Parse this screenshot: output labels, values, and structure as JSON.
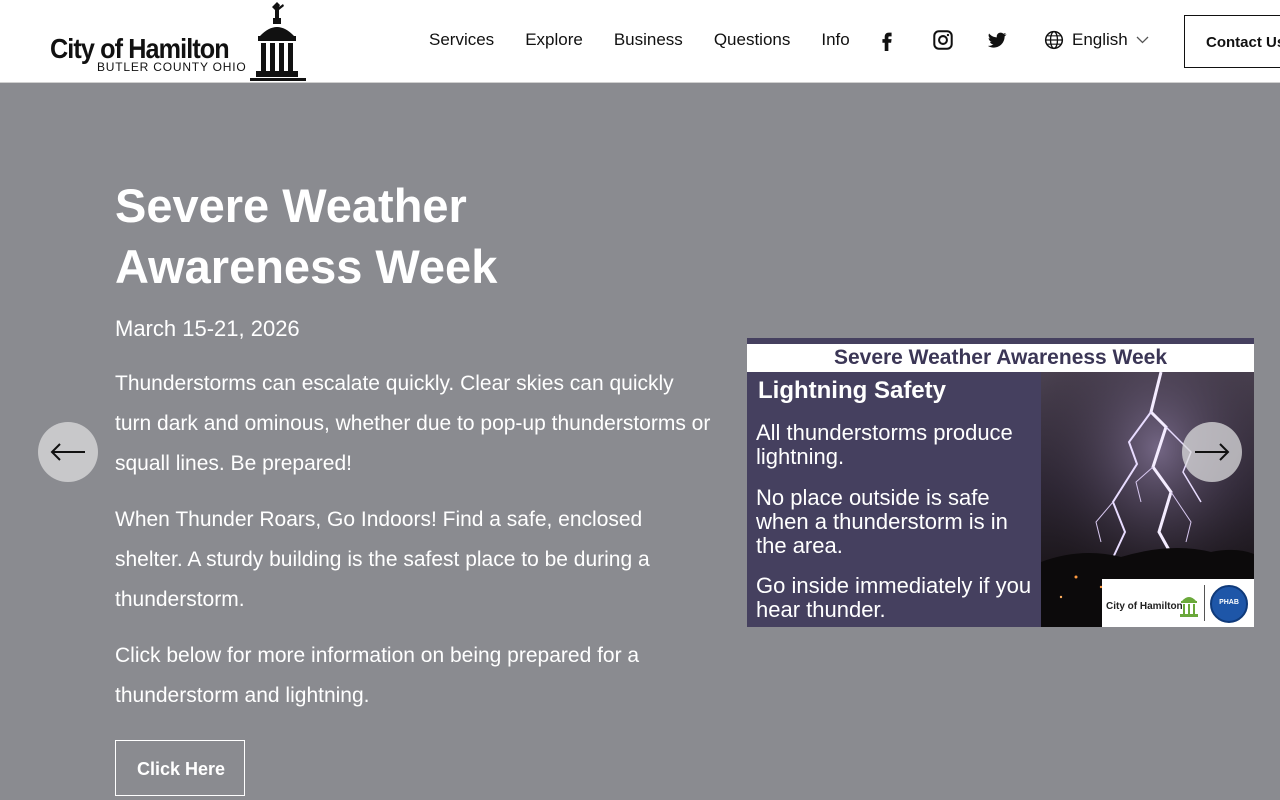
{
  "header": {
    "logo": {
      "title": "City of Hamilton",
      "subtitle": "BUTLER COUNTY OHIO"
    },
    "nav": [
      {
        "label": "Services"
      },
      {
        "label": "Explore"
      },
      {
        "label": "Business"
      },
      {
        "label": "Questions"
      },
      {
        "label": "Info"
      }
    ],
    "social": [
      {
        "icon": "facebook-icon"
      },
      {
        "icon": "instagram-icon"
      },
      {
        "icon": "twitter-icon"
      }
    ],
    "language": {
      "icon": "globe-icon",
      "label": "English"
    },
    "contact_label": "Contact Us"
  },
  "hero": {
    "title": "Severe Weather Awareness Week",
    "date": "March 15-21, 2026",
    "paragraphs": [
      "Thunderstorms can escalate quickly.  Clear skies can quickly turn dark and ominous, whether due to pop-up thunderstorms or squall lines.  Be prepared!",
      "When Thunder Roars, Go Indoors!  Find a safe, enclosed shelter.  A sturdy building is the safest place to be during a thunderstorm.",
      "Click below for more information on being prepared for a thunderstorm and lightning."
    ],
    "cta_label": "Click Here",
    "prev_icon": "arrow-left-icon",
    "next_icon": "arrow-right-icon"
  },
  "graphic": {
    "banner": "Severe Weather Awareness Week",
    "heading": "Lightning Safety",
    "lines": [
      "All thunderstorms produce lightning.",
      "No place outside is safe when a thunderstorm is in the area.",
      "Go inside immediately if you hear thunder."
    ],
    "badge_name": "City of Hamilton",
    "seal_text": "PHAB"
  },
  "colors": {
    "hero_bg": "#8a8b90",
    "graphic_bg": "#45405f",
    "header_bg": "#ffffff"
  }
}
